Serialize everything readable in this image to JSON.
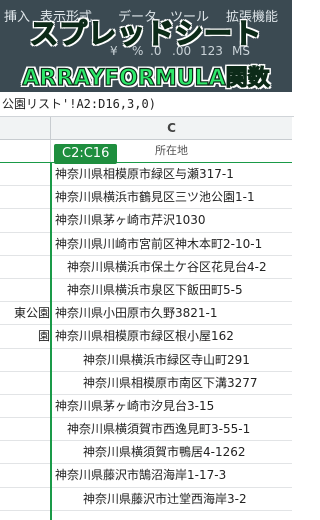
{
  "menu": {
    "items": [
      "挿入",
      "表示形式",
      "データ",
      "ツール",
      "拡張機能"
    ]
  },
  "toolbar": {
    "items": [
      "¥",
      "%",
      ".0",
      ".00",
      "123",
      "MS"
    ]
  },
  "overlay": {
    "title": "スプレッドシート",
    "subtitle": "ARRAYFORMULA関数",
    "title_color": "#2fe86a"
  },
  "formula_bar": {
    "text": "公園リスト'!A2:D16,3,0)"
  },
  "sheet": {
    "column_letter": "C",
    "range_badge": "C2:C16",
    "header_label": "所在地",
    "accent_color": "#1e8e3e",
    "rows": [
      {
        "a": "",
        "c": "神奈川県相模原市緑区与瀬317-1"
      },
      {
        "a": "",
        "c": "神奈川県横浜市鶴見区三ツ池公園1-1"
      },
      {
        "a": "",
        "c": "神奈川県茅ヶ崎市芹沢1030"
      },
      {
        "a": "",
        "c": "神奈川県川崎市宮前区神木本町2-10-1"
      },
      {
        "a": "",
        "c": "神奈川県横浜市保土ケ谷区花見台4-2"
      },
      {
        "a": "",
        "c": "神奈川県横浜市泉区下飯田町5-5"
      },
      {
        "a": "東公園",
        "c": "神奈川県小田原市久野3821-1"
      },
      {
        "a": "園",
        "c": "神奈川県相模原市緑区根小屋162"
      },
      {
        "a": "",
        "c": "神奈川県横浜市緑区寺山町291"
      },
      {
        "a": "",
        "c": "神奈川県相模原市南区下溝3277"
      },
      {
        "a": "",
        "c": "神奈川県茅ヶ崎市汐見台3-15"
      },
      {
        "a": "",
        "c": "神奈川県横須賀市西逸見町3-55-1"
      },
      {
        "a": "",
        "c": "神奈川県横須賀市鴨居4-1262"
      },
      {
        "a": "",
        "c": "神奈川県藤沢市鵠沼海岸1-17-3"
      },
      {
        "a": "",
        "c": "神奈川県藤沢市辻堂西海岸3-2"
      }
    ]
  }
}
